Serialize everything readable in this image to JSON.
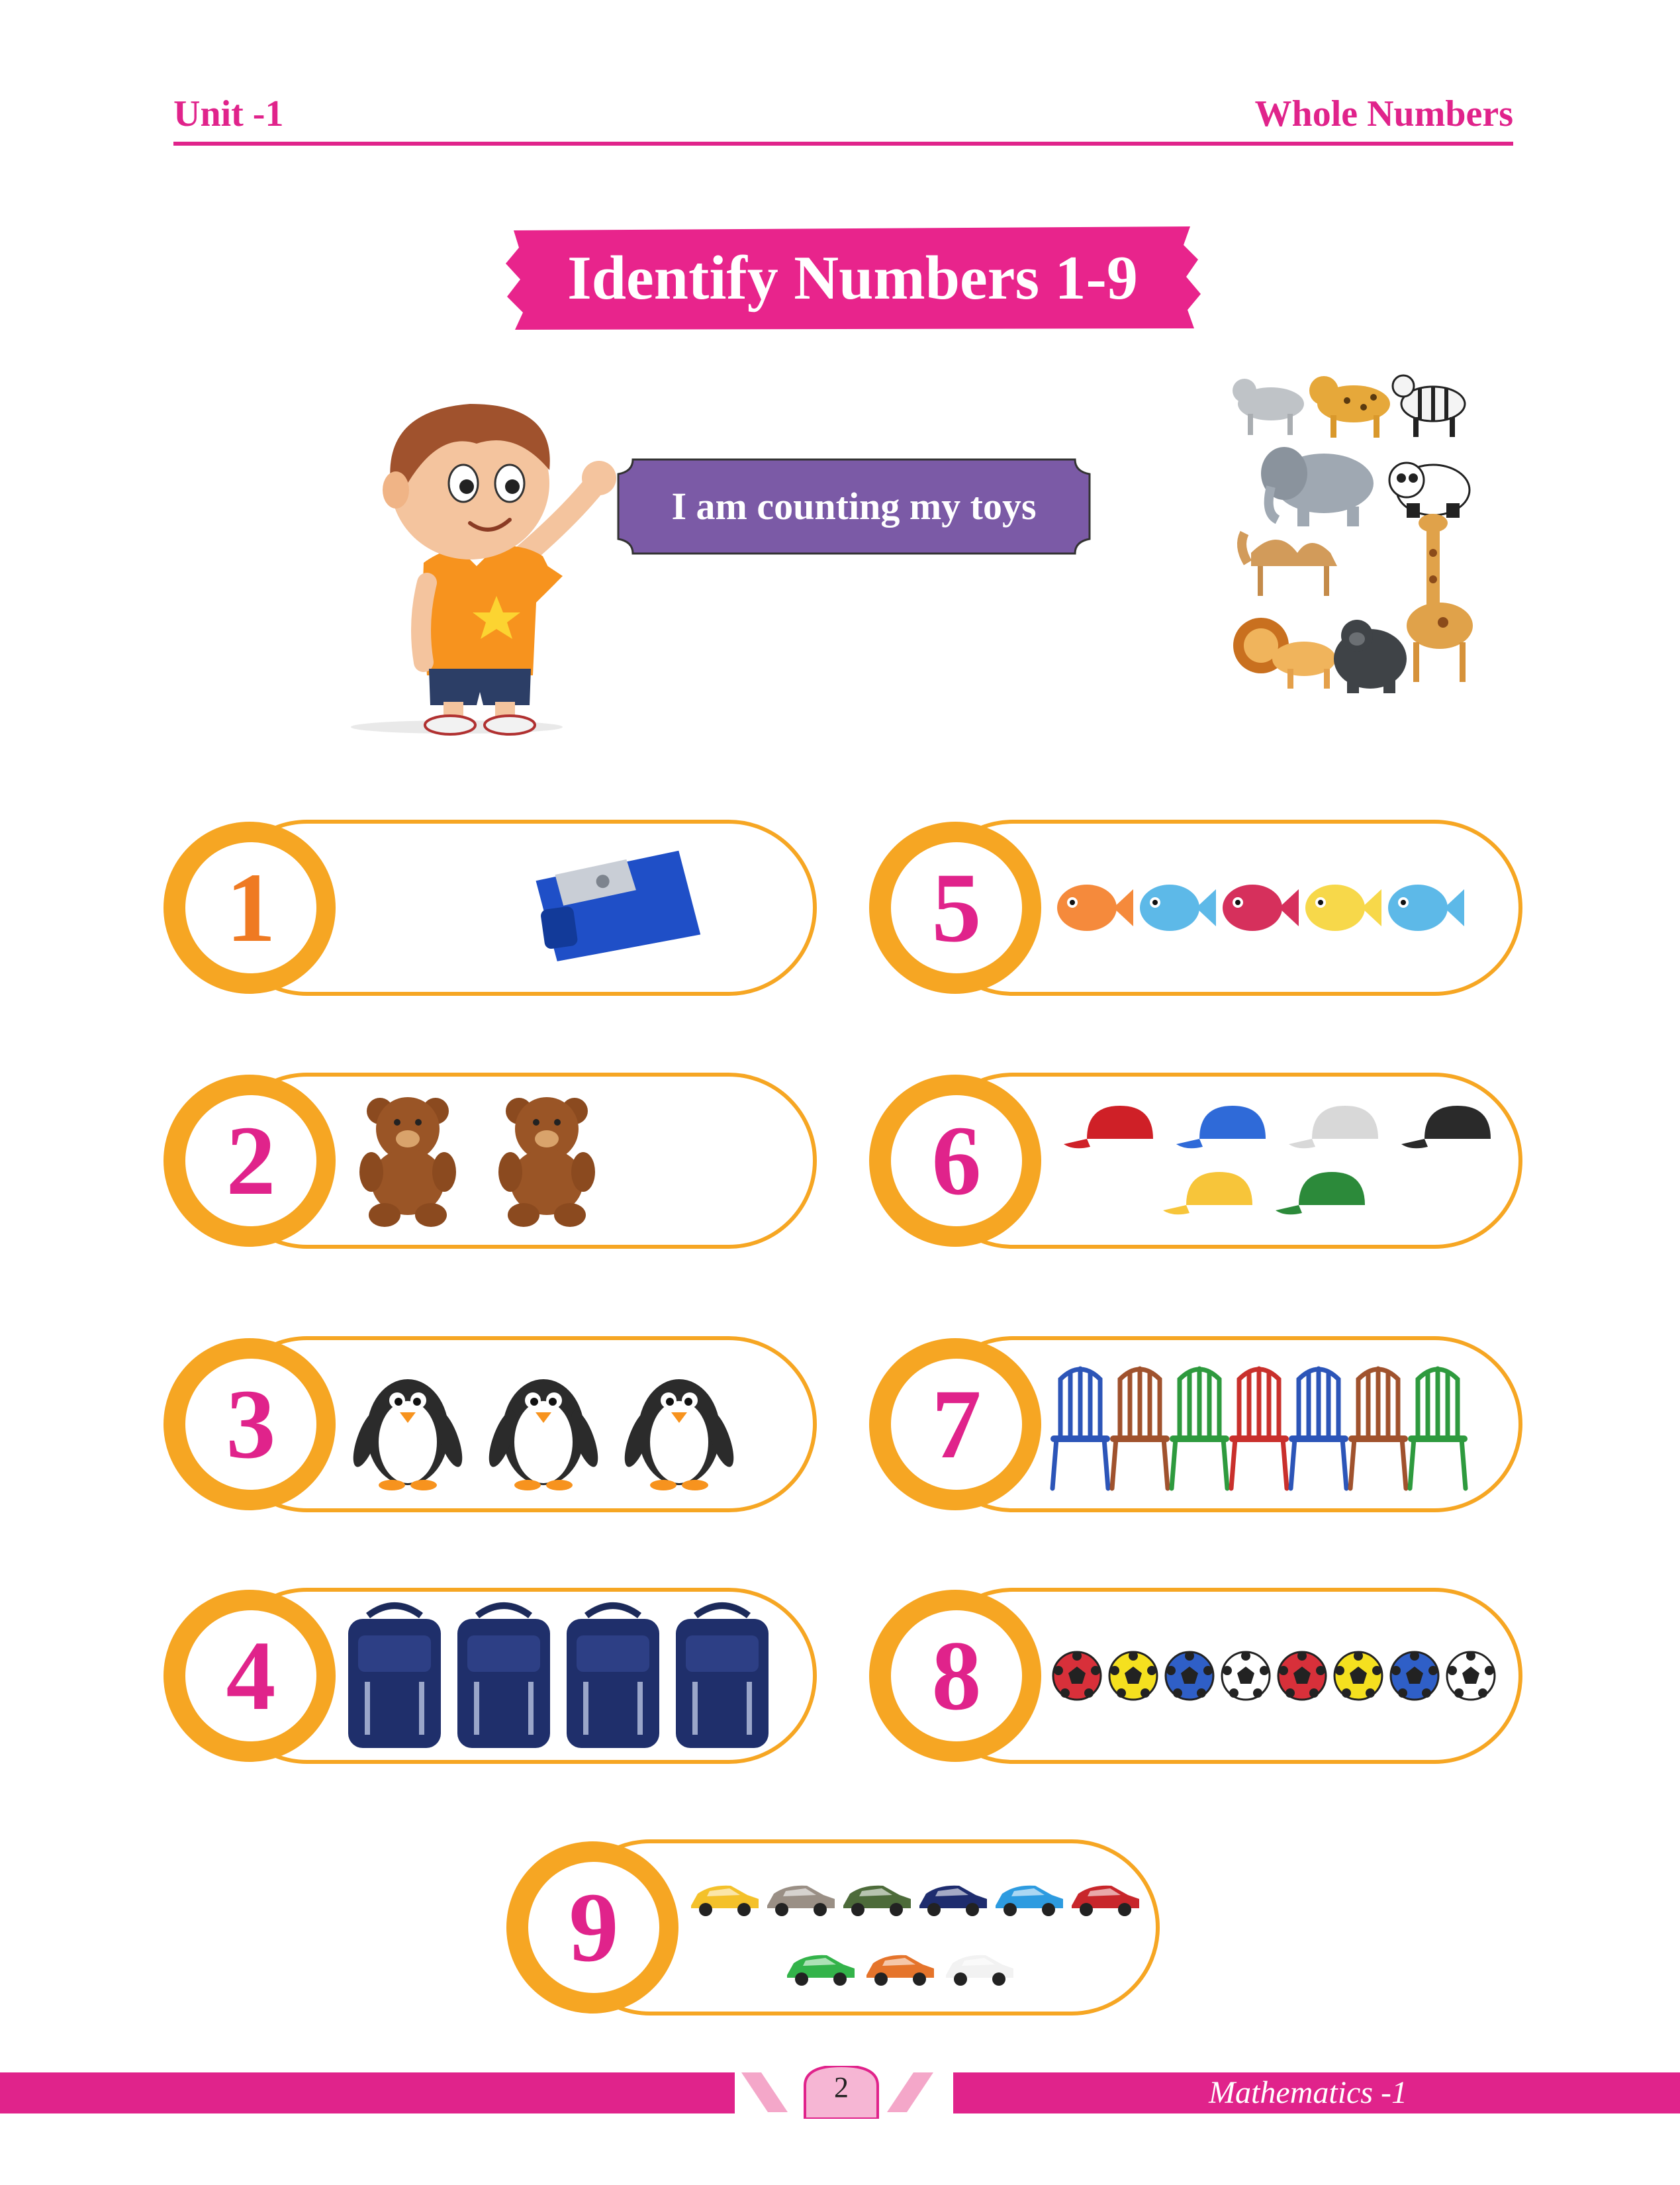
{
  "header": {
    "unit": "Unit -1",
    "topic": "Whole Numbers"
  },
  "title": "Identify Numbers 1-9",
  "speech": "I am counting my toys",
  "colors": {
    "magenta": "#e0238b",
    "orange": "#f6a623",
    "purple": "#7b5aa6"
  },
  "rows": [
    {
      "number": "1",
      "item": "sharpener"
    },
    {
      "number": "2",
      "item": "teddy-bear"
    },
    {
      "number": "3",
      "item": "penguin"
    },
    {
      "number": "4",
      "item": "school-bag"
    },
    {
      "number": "5",
      "item": "fish"
    },
    {
      "number": "6",
      "item": "cap"
    },
    {
      "number": "7",
      "item": "chair"
    },
    {
      "number": "8",
      "item": "football"
    },
    {
      "number": "9",
      "item": "toy-car"
    }
  ],
  "footer": {
    "page": "2",
    "book": "Mathematics -1"
  }
}
